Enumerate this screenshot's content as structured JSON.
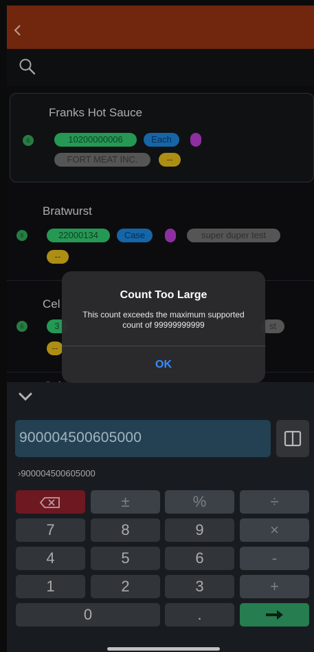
{
  "list": {
    "items": [
      {
        "title": "Franks Hot Sauce",
        "badge": "6",
        "code": "10200000006",
        "unit": "Each",
        "vendor": "FORT MEAT INC.",
        "tag": "--"
      },
      {
        "title": "Bratwurst",
        "badge": "6",
        "code": "22000134",
        "unit": "Case",
        "note": "super duper test",
        "tag": "--"
      },
      {
        "title": "Cel",
        "badge": "6",
        "code": "3",
        "note": "st",
        "tag": "--"
      },
      {
        "title": "Spice, Old Bay"
      }
    ]
  },
  "alert": {
    "title": "Count Too Large",
    "message": "This count exceeds the maximum supported count of 99999999999",
    "ok_label": "OK"
  },
  "entry": {
    "value": "900004500605000",
    "expression": "›900004500605000"
  },
  "keypad": {
    "row1": [
      "±",
      "%",
      "÷"
    ],
    "row2": [
      "7",
      "8",
      "9",
      "×"
    ],
    "row3": [
      "4",
      "5",
      "6",
      "-"
    ],
    "row4": [
      "1",
      "2",
      "3",
      "+"
    ],
    "row5": [
      "0",
      "."
    ]
  },
  "colors": {
    "accent": "#8e3112",
    "entry_bg": "#2d5168",
    "delete": "#8a1f2b",
    "enter": "#2f9d64",
    "alert_button": "#3b8cff"
  },
  "icons": [
    "back-chevron-icon",
    "search-icon",
    "collapse-chevron-icon",
    "book-icon",
    "backspace-icon",
    "enter-arrow-icon"
  ]
}
